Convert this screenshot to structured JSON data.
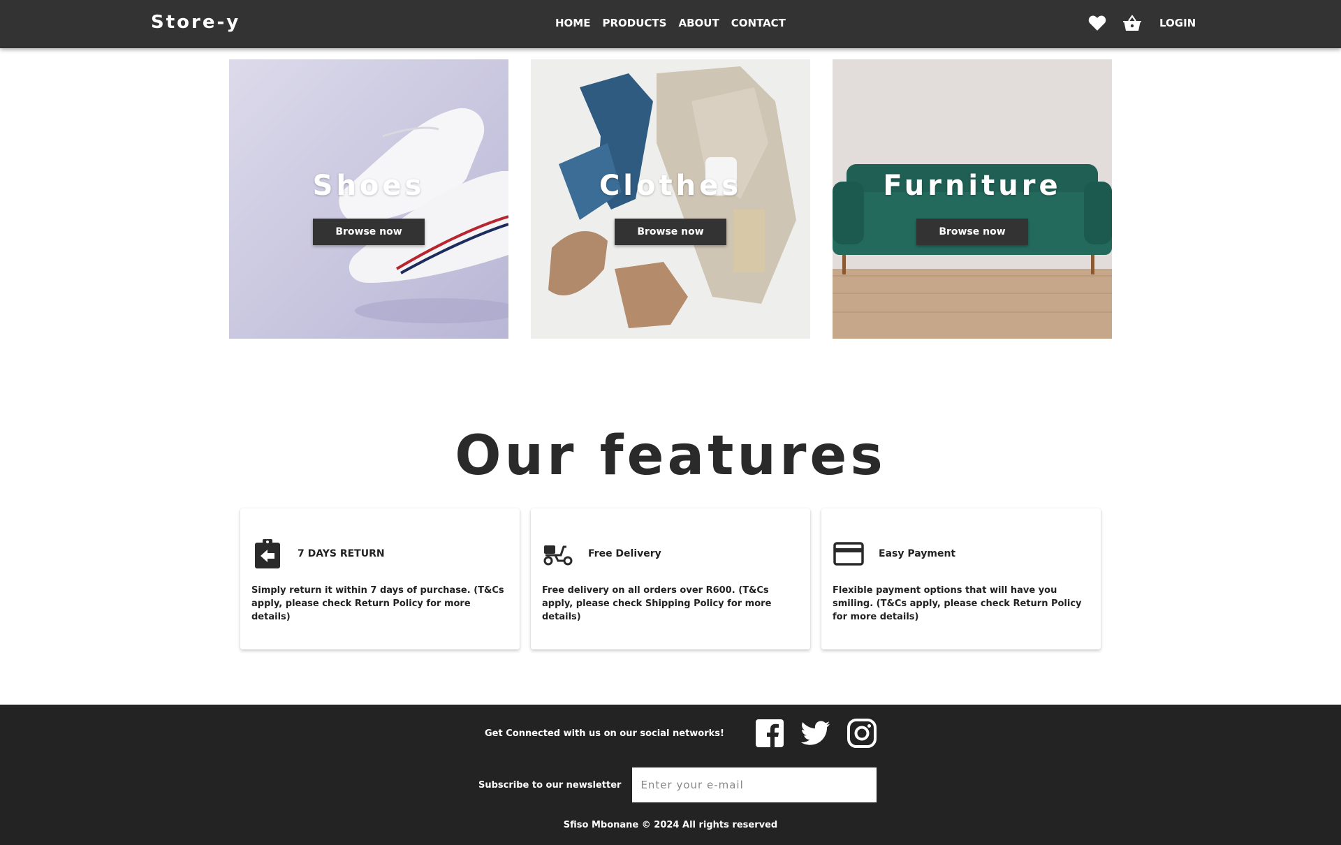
{
  "navbar": {
    "brand": "Store-y",
    "links": [
      "HOME",
      "PRODUCTS",
      "ABOUT",
      "CONTACT"
    ],
    "login": "LOGIN",
    "icons": [
      "heart-icon",
      "basket-icon"
    ]
  },
  "categories": [
    {
      "title": "Shoes",
      "button": "Browse now"
    },
    {
      "title": "Clothes",
      "button": "Browse now"
    },
    {
      "title": "Furniture",
      "button": "Browse now"
    }
  ],
  "features": {
    "heading": "Our features",
    "items": [
      {
        "icon": "return-clipboard-icon",
        "title": "7 DAYS RETURN",
        "text": "Simply return it within 7 days of purchase. (T&Cs apply, please check Return Policy for more details)"
      },
      {
        "icon": "scooter-icon",
        "title": "Free Delivery",
        "text": "Free delivery on all orders over R600. (T&Cs apply, please check Shipping Policy for more details)"
      },
      {
        "icon": "credit-card-icon",
        "title": "Easy Payment",
        "text": "Flexible payment options that will have you smiling. (T&Cs apply, please check Return Policy for more details)"
      }
    ]
  },
  "footer": {
    "social_text": "Get Connected with us on our social networks!",
    "social_icons": [
      "facebook-icon",
      "twitter-icon",
      "instagram-icon"
    ],
    "newsletter_label": "Subscribe to our newsletter",
    "newsletter_placeholder": "Enter your e-mail",
    "copyright": "Sfiso Mbonane © 2024 All rights reserved"
  },
  "colors": {
    "navbar": "#333333",
    "footer": "#232323",
    "button": "#333333",
    "text": "#222222"
  }
}
